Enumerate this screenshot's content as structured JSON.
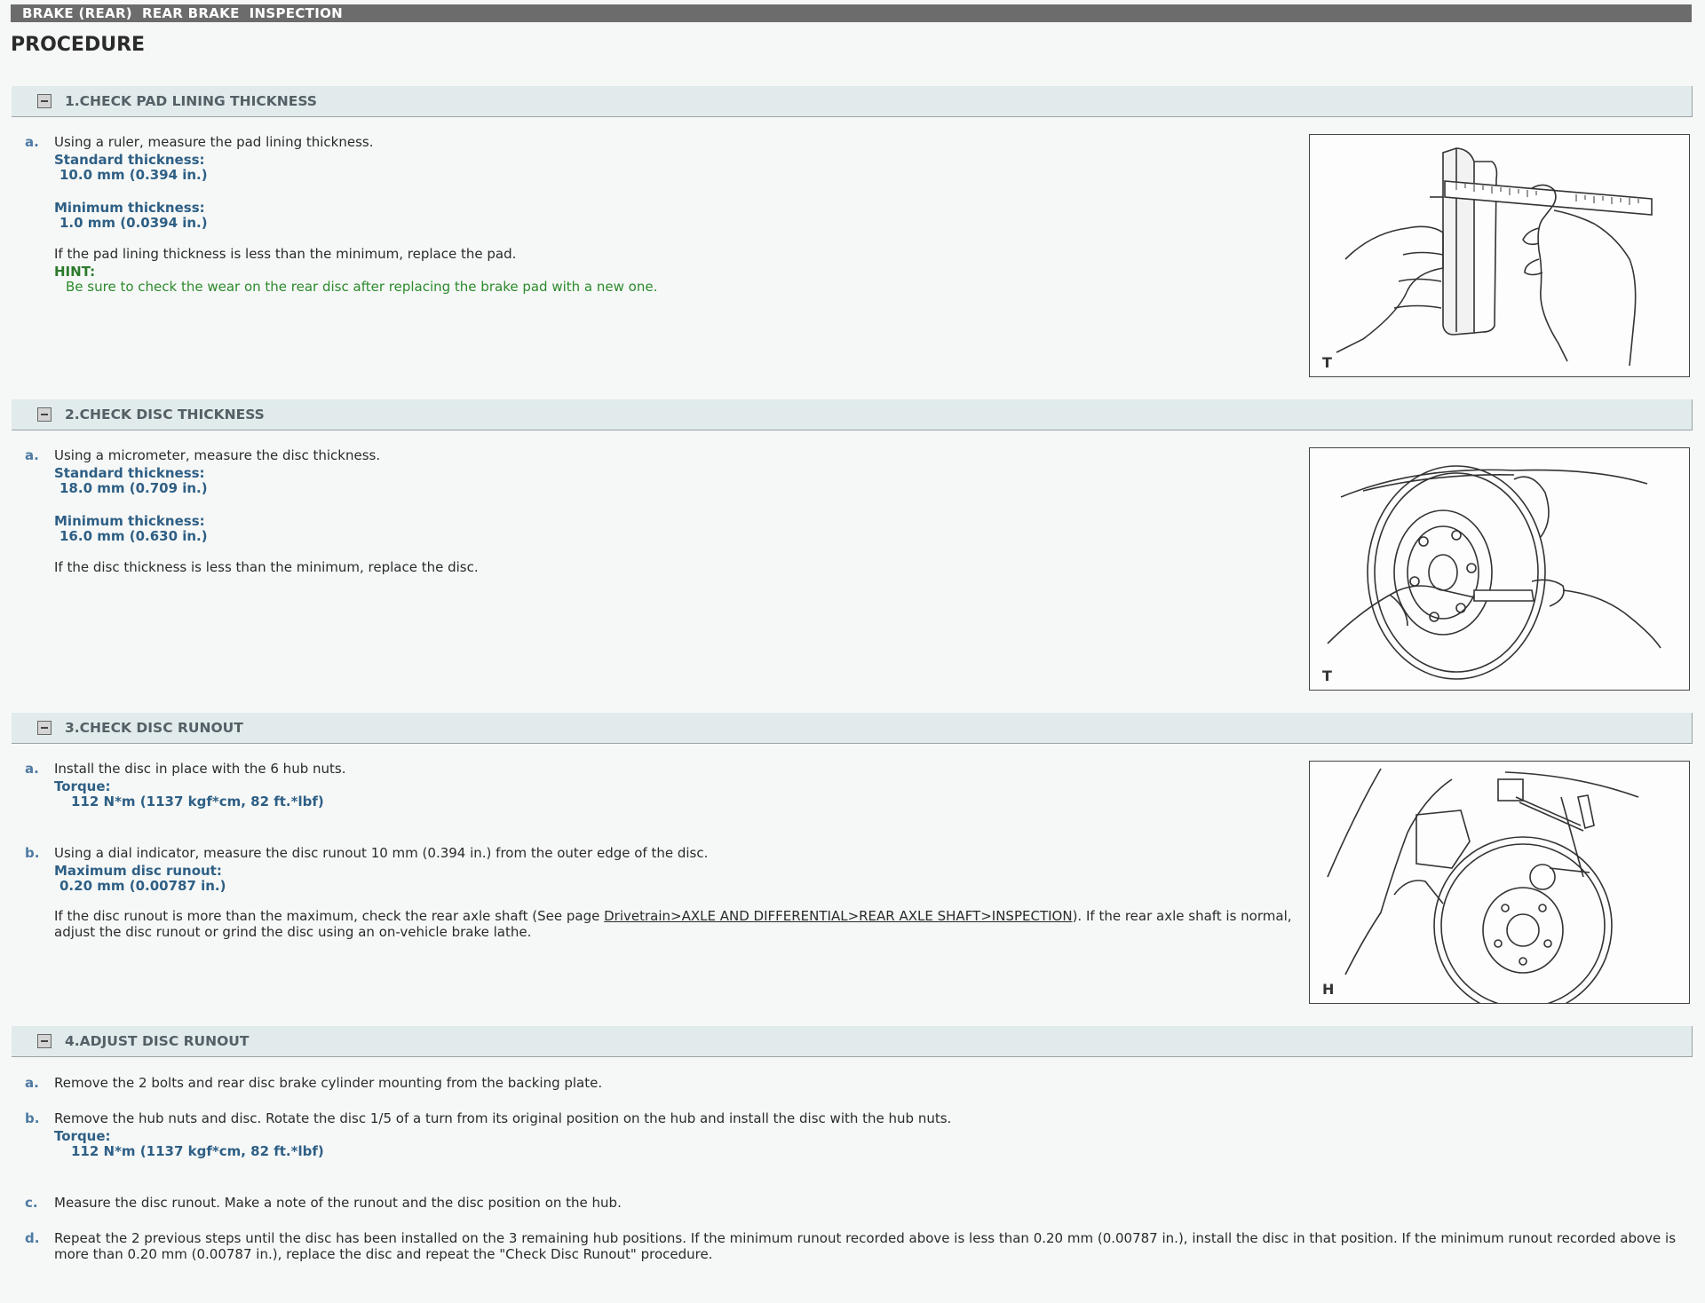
{
  "header": {
    "breadcrumb": "BRAKE (REAR)  REAR BRAKE  INSPECTION"
  },
  "page_title": "PROCEDURE",
  "sections": [
    {
      "title": "1.CHECK PAD LINING THICKNESS",
      "figure_code": "T",
      "steps": [
        {
          "letter": "a.",
          "text": "Using a ruler, measure the pad lining thickness.",
          "spec1_label": "Standard thickness:",
          "spec1_value": "10.0 mm (0.394 in.)",
          "spec2_label": "Minimum thickness:",
          "spec2_value": "1.0 mm (0.0394 in.)",
          "note": "If the pad lining thickness is less than the minimum, replace the pad.",
          "hint_label": "HINT:",
          "hint_text": "Be sure to check the wear on the rear disc after replacing the brake pad with a new one."
        }
      ]
    },
    {
      "title": "2.CHECK DISC THICKNESS",
      "figure_code": "T",
      "steps": [
        {
          "letter": "a.",
          "text": "Using a micrometer, measure the disc thickness.",
          "spec1_label": "Standard thickness:",
          "spec1_value": "18.0 mm (0.709 in.)",
          "spec2_label": "Minimum thickness:",
          "spec2_value": "16.0 mm (0.630 in.)",
          "note": "If the disc thickness is less than the minimum, replace the disc."
        }
      ]
    },
    {
      "title": "3.CHECK DISC RUNOUT",
      "figure_code": "H",
      "steps": [
        {
          "letter": "a.",
          "text": "Install the disc in place with the 6 hub nuts.",
          "spec_label": "Torque:",
          "spec_value": "112 N*m (1137 kgf*cm, 82 ft.*lbf)"
        },
        {
          "letter": "b.",
          "text": "Using a dial indicator, measure the disc runout 10 mm (0.394 in.) from the outer edge of the disc.",
          "spec_label": "Maximum disc runout:",
          "spec_value": "0.20 mm (0.00787 in.)",
          "note_before": "If the disc runout is more than the maximum, check the rear axle shaft (See page ",
          "note_link": "Drivetrain>AXLE AND DIFFERENTIAL>REAR AXLE SHAFT>INSPECTION",
          "note_after": "). If the rear axle shaft is normal, adjust the disc runout or grind the disc using an on-vehicle brake lathe."
        }
      ]
    },
    {
      "title": "4.ADJUST DISC RUNOUT",
      "steps": [
        {
          "letter": "a.",
          "text": "Remove the 2 bolts and rear disc brake cylinder mounting from the backing plate."
        },
        {
          "letter": "b.",
          "text": "Remove the hub nuts and disc. Rotate the disc 1/5 of a turn from its original position on the hub and install the disc with the hub nuts.",
          "spec_label": "Torque:",
          "spec_value": "112 N*m (1137 kgf*cm, 82 ft.*lbf)"
        },
        {
          "letter": "c.",
          "text": "Measure the disc runout. Make a note of the runout and the disc position on the hub."
        },
        {
          "letter": "d.",
          "text": "Repeat the 2 previous steps until the disc has been installed on the 3 remaining hub positions. If the minimum runout recorded above is less than 0.20 mm (0.00787 in.), install the disc in that position. If the minimum runout recorded above is more than 0.20 mm (0.00787 in.), replace the disc and repeat the \"Check Disc Runout\" procedure."
        }
      ]
    }
  ]
}
